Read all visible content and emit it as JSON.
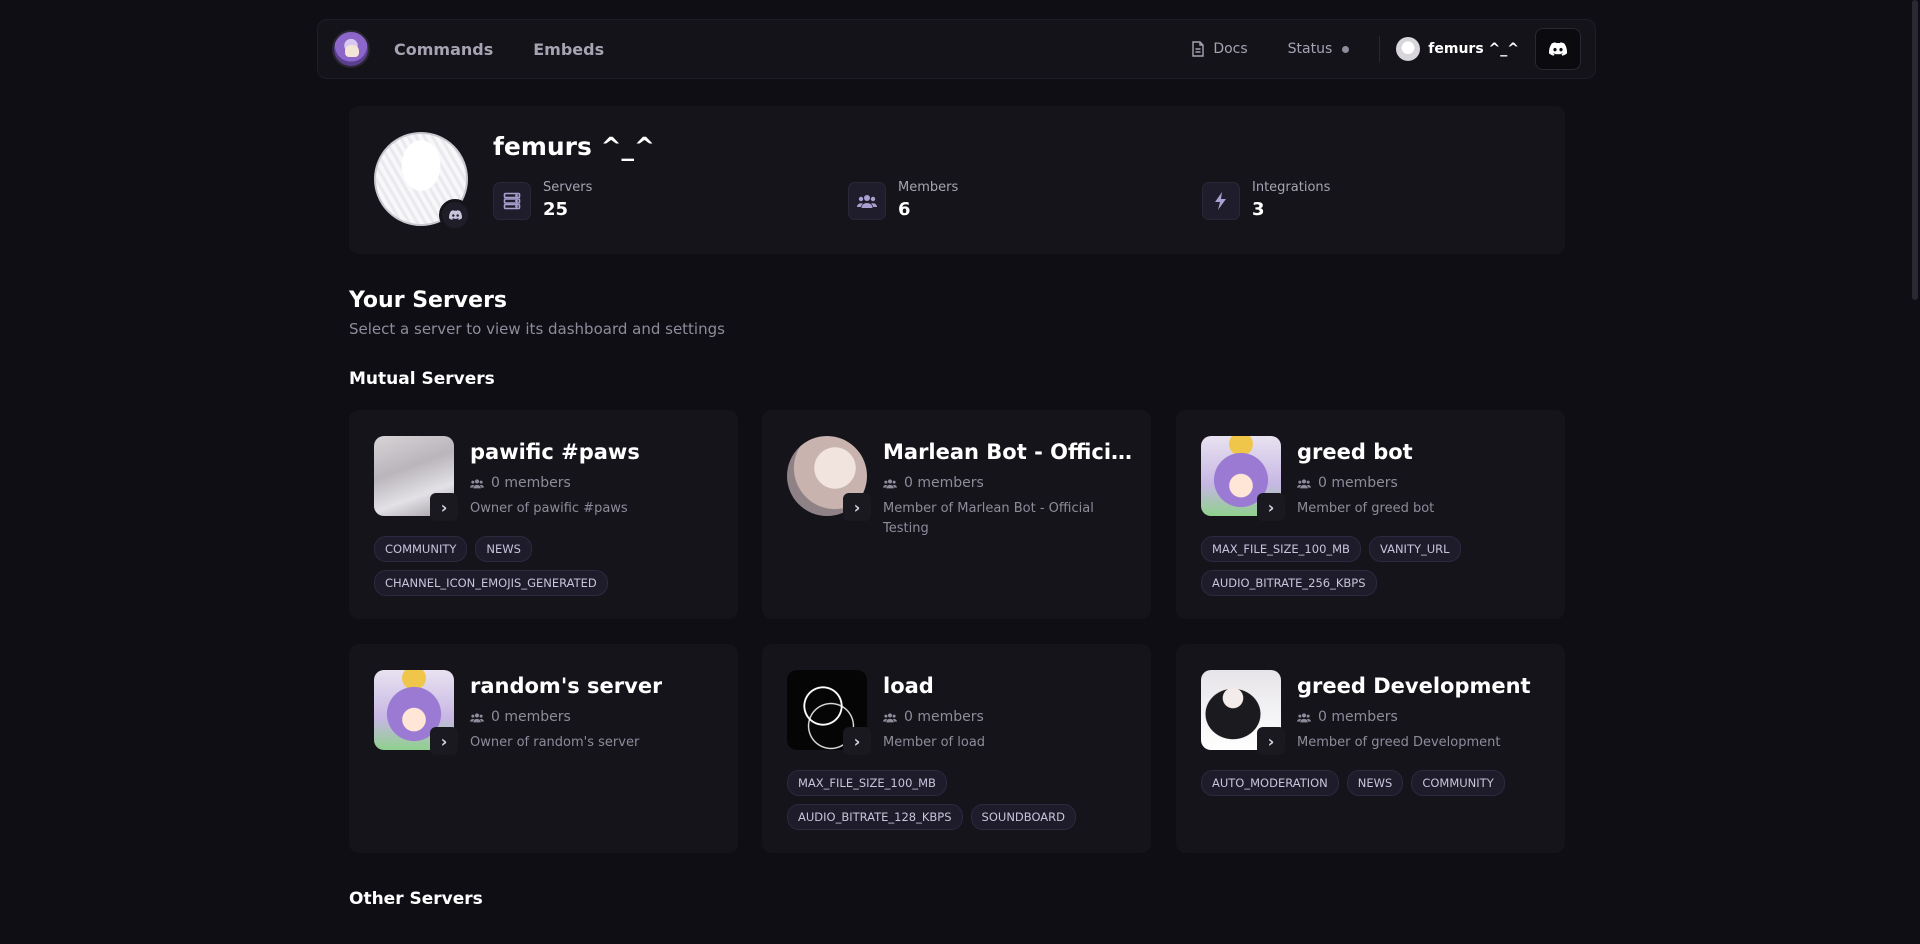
{
  "nav": {
    "commands": "Commands",
    "embeds": "Embeds",
    "docs": "Docs",
    "status": "Status",
    "user_name": "femurs ^_^"
  },
  "profile": {
    "name": "femurs ^_^",
    "stats": [
      {
        "label": "Servers",
        "value": "25",
        "icon": "server-icon"
      },
      {
        "label": "Members",
        "value": "6",
        "icon": "users-icon"
      },
      {
        "label": "Integrations",
        "value": "3",
        "icon": "bolt-icon"
      }
    ]
  },
  "servers_section": {
    "title": "Your Servers",
    "subtitle": "Select a server to view its dashboard and settings",
    "mutual_title": "Mutual Servers",
    "other_title": "Other Servers"
  },
  "mutual_servers": [
    {
      "name": "pawific #paws",
      "members": "0 members",
      "role": "Owner of pawific #paws",
      "tags": [
        "COMMUNITY",
        "NEWS",
        "CHANNEL_ICON_EMOJIS_GENERATED"
      ]
    },
    {
      "name": "Marlean Bot - Official Te...",
      "members": "0 members",
      "role": "Member of Marlean Bot - Official Testing",
      "tags": []
    },
    {
      "name": "greed bot",
      "members": "0 members",
      "role": "Member of greed bot",
      "tags": [
        "MAX_FILE_SIZE_100_MB",
        "VANITY_URL",
        "AUDIO_BITRATE_256_KBPS"
      ]
    },
    {
      "name": "random's server",
      "members": "0 members",
      "role": "Owner of random's server",
      "tags": []
    },
    {
      "name": "load",
      "members": "0 members",
      "role": "Member of load",
      "tags": [
        "MAX_FILE_SIZE_100_MB",
        "AUDIO_BITRATE_128_KBPS",
        "SOUNDBOARD"
      ]
    },
    {
      "name": "greed Development",
      "members": "0 members",
      "role": "Member of greed Development",
      "tags": [
        "AUTO_MODERATION",
        "NEWS",
        "COMMUNITY"
      ]
    }
  ]
}
